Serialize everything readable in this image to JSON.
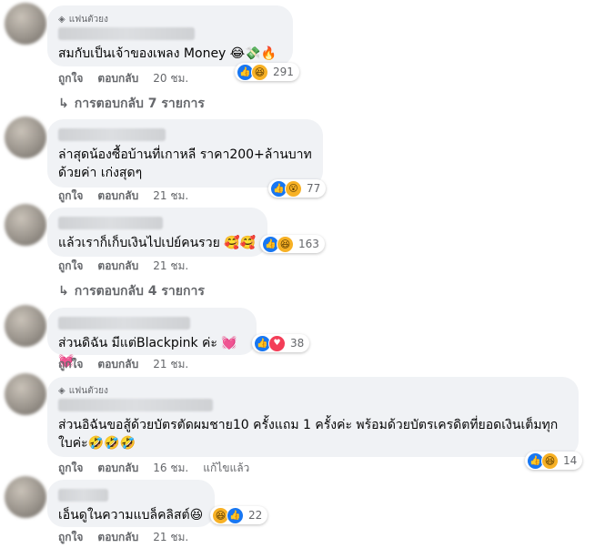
{
  "comments": [
    {
      "badge": "แฟนตัวยง",
      "text": "สมกับเป็นเจ้าของเพลง Money 😂💸🔥",
      "reactions": [
        "like",
        "haha"
      ],
      "count": "291",
      "like": "ถูกใจ",
      "reply": "ตอบกลับ",
      "time": "20 ชม.",
      "replies": "การตอบกลับ 7 รายการ"
    },
    {
      "badge": "",
      "text": "ล่าสุดน้องซื้อบ้านที่เกาหลี ราคา200+ล้านบาท\nด้วยค่า เก่งสุดๆ",
      "reactions": [
        "like",
        "wow"
      ],
      "count": "77",
      "like": "ถูกใจ",
      "reply": "ตอบกลับ",
      "time": "21 ชม.",
      "replies": ""
    },
    {
      "badge": "",
      "text": "แล้วเราก็เก็บเงินไปเปย์คนรวย 🥰🥰",
      "reactions": [
        "like",
        "haha"
      ],
      "count": "163",
      "like": "ถูกใจ",
      "reply": "ตอบกลับ",
      "time": "21 ชม.",
      "replies": "การตอบกลับ 4 รายการ"
    },
    {
      "badge": "",
      "text": "ส่วนดิฉัน มีแต่Blackpink ค่ะ 💓💓",
      "reactions": [
        "like",
        "love"
      ],
      "count": "38",
      "like": "ถูกใจ",
      "reply": "ตอบกลับ",
      "time": "21 ชม.",
      "replies": ""
    },
    {
      "badge": "แฟนตัวยง",
      "text": "ส่วนอิฉันขอสู้ด้วยบัตรตัดผมชาย10 ครั้งแถม 1 ครั้งค่ะ พร้อมด้วยบัตรเครดิตที่ยอดเงินเต็มทุก\nใบค่ะ🤣🤣🤣",
      "reactions": [
        "like",
        "haha"
      ],
      "count": "14",
      "like": "ถูกใจ",
      "reply": "ตอบกลับ",
      "time": "16 ชม.",
      "edited": "แก้ไขแล้ว",
      "replies": ""
    },
    {
      "badge": "",
      "text": "เอ็นดูในความแบล็คลิสต์😆",
      "reactions": [
        "haha",
        "like"
      ],
      "count": "22",
      "like": "ถูกใจ",
      "reply": "ตอบกลับ",
      "time": "21 ชม.",
      "replies": ""
    }
  ]
}
